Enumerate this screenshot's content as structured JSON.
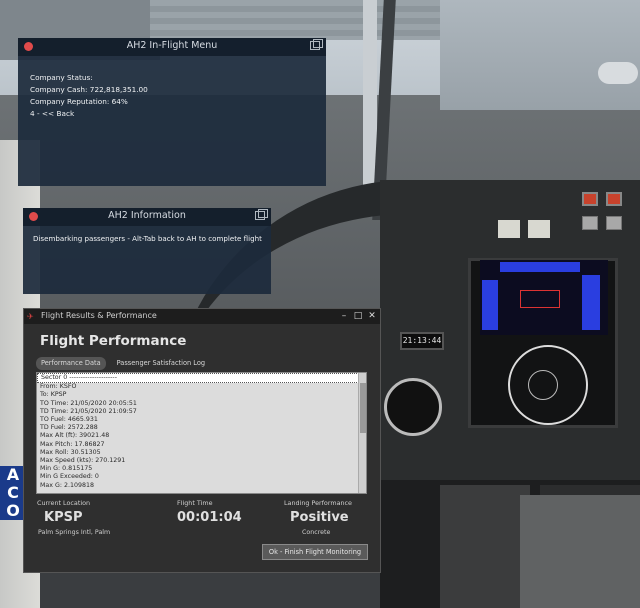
{
  "cockpit": {
    "abc_buttons": [
      "A",
      "C",
      "O"
    ],
    "clock_readout": "21:13:44"
  },
  "menu_window": {
    "title": "AH2 In-Flight Menu",
    "lines": [
      "Company Status:",
      "Company Cash: 722,818,351.00",
      "Company Reputation: 64%",
      "4 - << Back"
    ]
  },
  "info_window": {
    "title": "AH2 Information",
    "message": "Disembarking passengers - Alt-Tab back to AH to complete flight"
  },
  "results_window": {
    "title": "Flight Results & Performance",
    "heading": "Flight Performance",
    "tabs": [
      "Performance Data",
      "Passenger Satisfaction Log"
    ],
    "active_tab": "Performance Data",
    "log_lines": [
      "Sector 0 ---------------------",
      "From: KSFO",
      "To: KPSP",
      "TO Time: 21/05/2020 20:05:51",
      "TD Time: 21/05/2020 21:09:57",
      "TO Fuel: 4665.931",
      "TD Fuel: 2572.288",
      "Max Alt (ft): 39021.48",
      "Max Pitch: 17.86827",
      "Max Roll: 30.51305",
      "Max Speed (kts): 270.1291",
      "Min G: 0.815175",
      "Min G Exceeded: 0",
      "Max G: 2.109818"
    ],
    "current_location": {
      "label": "Current Location",
      "value": "KPSP",
      "sub": "Palm Springs Intl, Palm"
    },
    "flight_time": {
      "label": "Flight Time",
      "value": "00:01:04"
    },
    "landing": {
      "label": "Landing Performance",
      "value": "Positive",
      "sub": "Concrete"
    },
    "finish_button": "Ok - Finish Flight Monitoring"
  }
}
